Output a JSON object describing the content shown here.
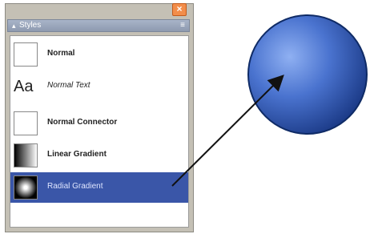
{
  "panel": {
    "title": "Styles",
    "close_glyph": "×",
    "collapse_glyph": "▴",
    "menu_glyph": "≡"
  },
  "styles": [
    {
      "label": "Normal",
      "thumb": "normal"
    },
    {
      "label": "Normal Text",
      "thumb_text": "Aa"
    },
    {
      "label": "Normal Connector",
      "thumb": "connector"
    },
    {
      "label": "Linear Gradient",
      "thumb": "linear"
    },
    {
      "label": "Radial Gradient",
      "thumb": "radial",
      "selected": true
    }
  ],
  "colors": {
    "selection": "#3a56a8",
    "sphere_light": "#6f95e6",
    "sphere_dark": "#1c3d8a"
  }
}
